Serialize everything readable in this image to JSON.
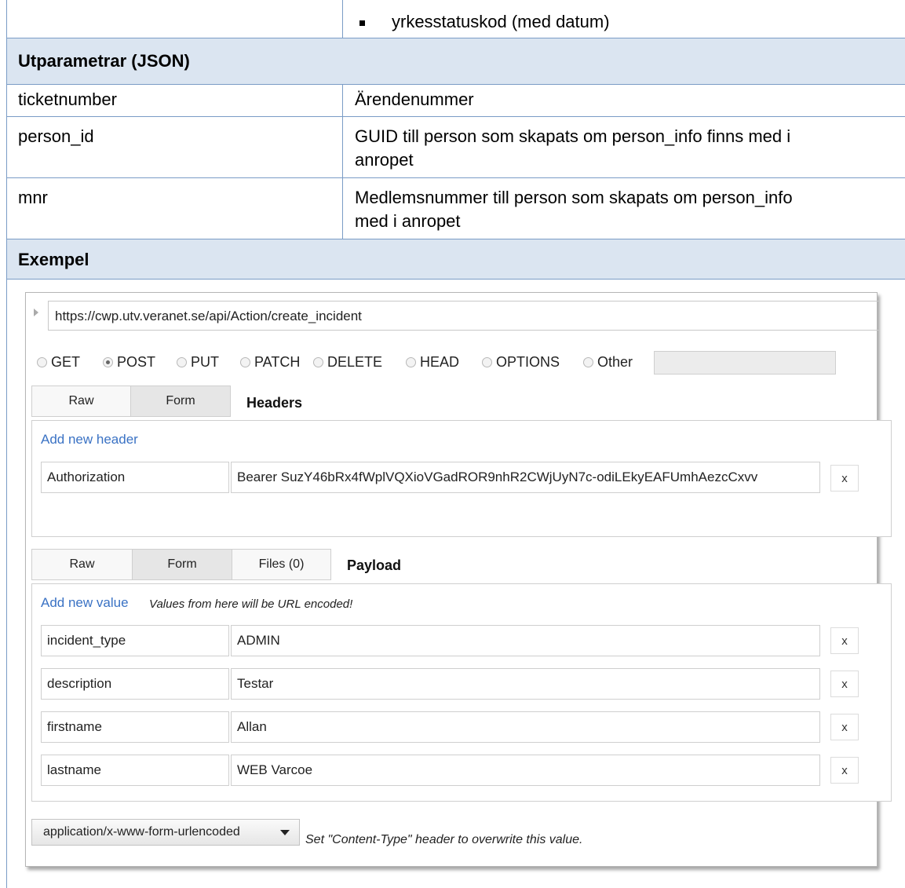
{
  "doc": {
    "top_bullet": "yrkesstatuskod (med datum)",
    "out_header": "Utparametrar (JSON)",
    "params": [
      {
        "name": "ticketnumber",
        "desc1": "Ärendenummer",
        "desc2": ""
      },
      {
        "name": "person_id",
        "desc1": "GUID till person som skapats om person_info finns med i",
        "desc2": "anropet"
      },
      {
        "name": "mnr",
        "desc1": "Medlemsnummer till person som skapats om person_info",
        "desc2": "med i anropet"
      }
    ],
    "example_header": "Exempel"
  },
  "client": {
    "url": "https://cwp.utv.veranet.se/api/Action/create_incident",
    "methods": [
      "GET",
      "POST",
      "PUT",
      "PATCH",
      "DELETE",
      "HEAD",
      "OPTIONS",
      "Other"
    ],
    "selected_method": "POST",
    "header_tabs": [
      "Raw",
      "Form"
    ],
    "headers_title": "Headers",
    "add_header": "Add new header",
    "header_rows": [
      {
        "key": "Authorization",
        "value": "Bearer SuzY46bRx4fWplVQXioVGadROR9nhR2CWjUyN7c-odiLEkyEAFUmhAezcCxvv"
      }
    ],
    "payload_tabs": [
      "Raw",
      "Form",
      "Files (0)"
    ],
    "payload_title": "Payload",
    "add_value": "Add new value",
    "encode_note": "Values from here will be URL encoded!",
    "payload_rows": [
      {
        "key": "incident_type",
        "value": "ADMIN"
      },
      {
        "key": "description",
        "value": "Testar"
      },
      {
        "key": "firstname",
        "value": "Allan"
      },
      {
        "key": "lastname",
        "value": "WEB Varcoe"
      }
    ],
    "remove_label": "x",
    "content_type": "application/x-www-form-urlencoded",
    "content_type_note": "Set \"Content-Type\" header to overwrite this value."
  }
}
